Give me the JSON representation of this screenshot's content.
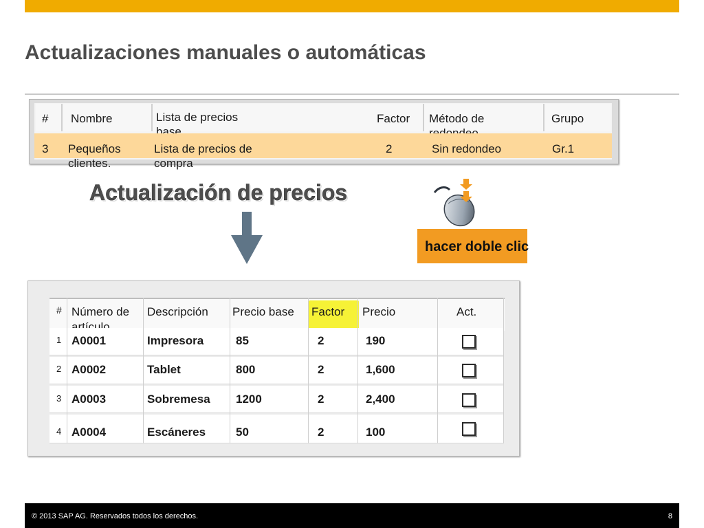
{
  "slide": {
    "title": "Actualizaciones manuales o automáticas",
    "footer_copyright": "© 2013 SAP AG. Reservados todos los derechos.",
    "page_number": "8",
    "colors": {
      "accent_bar": "#f0ab00",
      "row_highlight": "#fdd89a",
      "button": "#f29b22",
      "factor_highlight": "#f6f236"
    }
  },
  "price_list_table": {
    "headers": {
      "num": "#",
      "name": "Nombre",
      "base_list_l1": "Lista de precios",
      "base_list_l2": "base",
      "factor": "Factor",
      "rounding_l1": "Método de",
      "rounding_l2": "redondeo",
      "group": "Grupo"
    },
    "row": {
      "num": "3",
      "name_l1": "Pequeños",
      "name_l2": "clientes.",
      "base_list_l1": "Lista de precios de",
      "base_list_l2": "compra",
      "factor": "2",
      "rounding": "Sin redondeo",
      "group": "Gr.1"
    }
  },
  "update": {
    "heading": "Actualización de precios",
    "double_click_label": "hacer doble clic",
    "icons": {
      "arrow": "arrow-down-icon",
      "mouse": "mouse-icon"
    }
  },
  "items_table": {
    "headers": {
      "num": "#",
      "item_l1": "Número de",
      "item_l2": "artículo",
      "description": "Descripción",
      "base_price": "Precio base",
      "factor": "Factor",
      "price": "Precio",
      "update": "Act."
    },
    "rows": [
      {
        "idx": "1",
        "item": "A0001",
        "description": "Impresora",
        "base_price": "85",
        "factor": "2",
        "price": "190",
        "checked": false
      },
      {
        "idx": "2",
        "item": "A0002",
        "description": "Tablet",
        "base_price": "800",
        "factor": "2",
        "price": "1,600",
        "checked": false
      },
      {
        "idx": "3",
        "item": "A0003",
        "description": "Sobremesa",
        "base_price": "1200",
        "factor": "2",
        "price": "2,400",
        "checked": false
      },
      {
        "idx": "4",
        "item": "A0004",
        "description": "Escáneres",
        "base_price": "50",
        "factor": "2",
        "price": "100",
        "checked": false
      }
    ]
  }
}
